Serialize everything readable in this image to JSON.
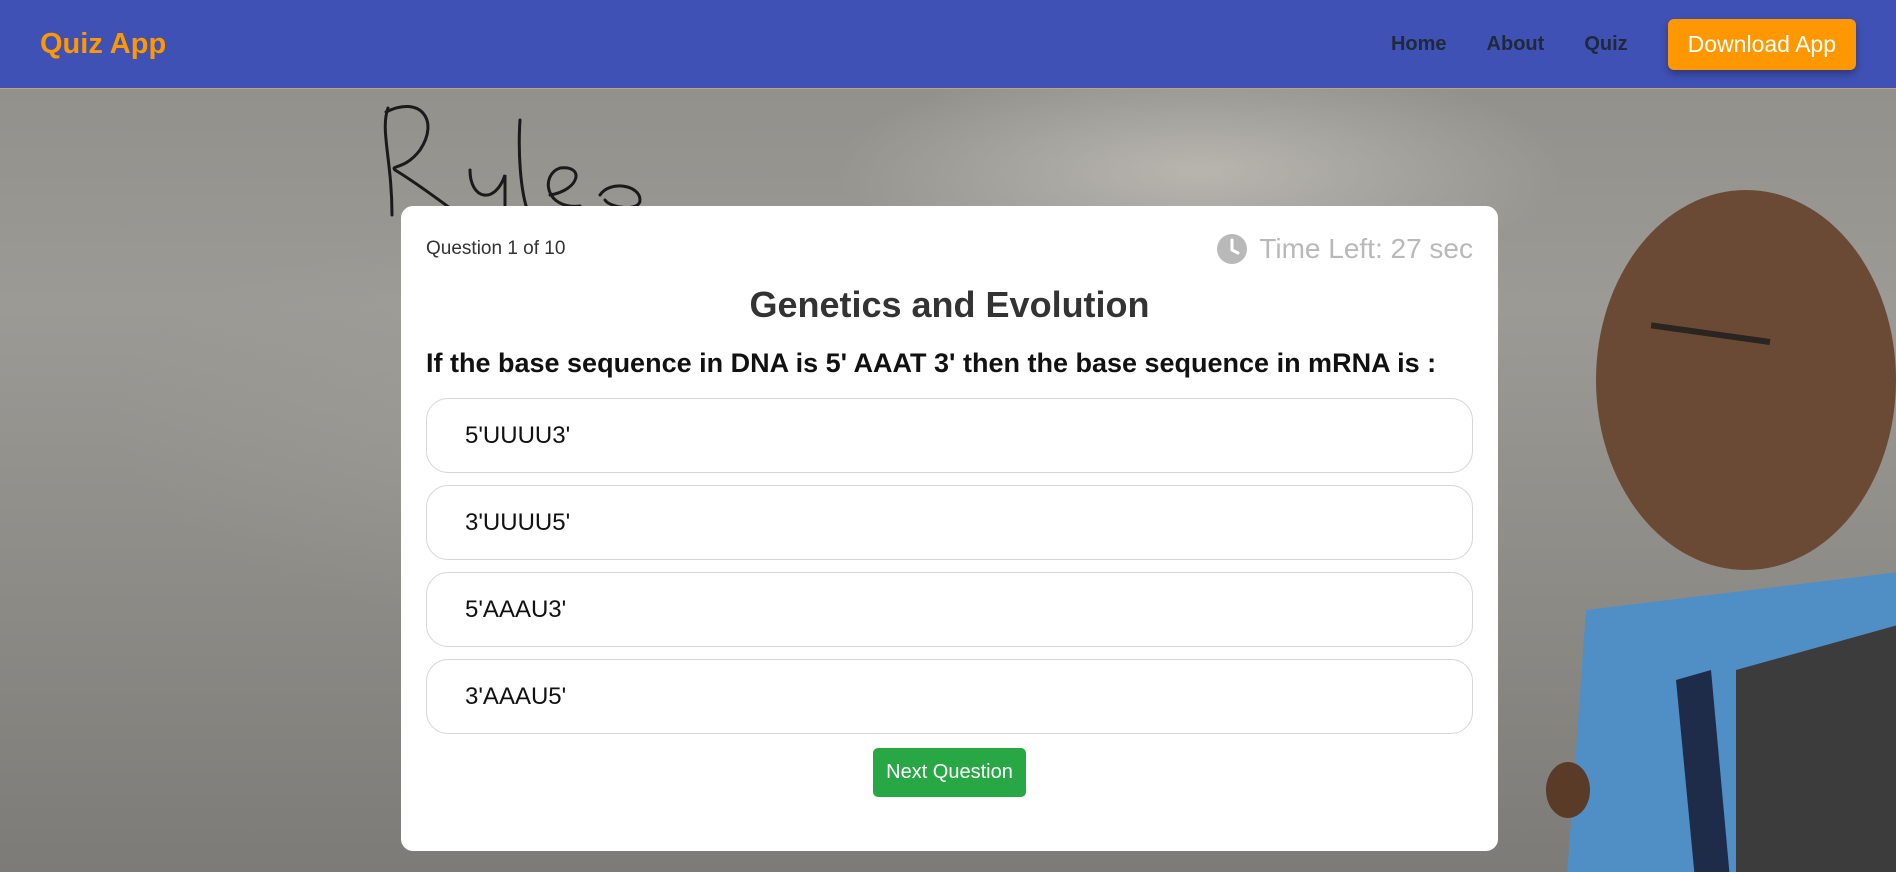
{
  "navbar": {
    "brand": "Quiz App",
    "links": [
      "Home",
      "About",
      "Quiz"
    ],
    "download_label": "Download App",
    "brand_color": "#ff9800",
    "bg_color": "#3f51b5"
  },
  "background": {
    "handwriting": "Rules"
  },
  "quiz": {
    "counter": "Question 1 of 10",
    "timer_icon": "clock-icon",
    "timer_text": "Time Left: 27 sec",
    "topic": "Genetics and Evolution",
    "question": "If the base sequence in DNA is 5' AAAT 3' then the base sequence in mRNA is :",
    "options": [
      "5'UUUU3'",
      "3'UUUU5'",
      "5'AAAU3'",
      "3'AAAU5'"
    ],
    "next_label": "Next Question",
    "next_color": "#28a745"
  }
}
